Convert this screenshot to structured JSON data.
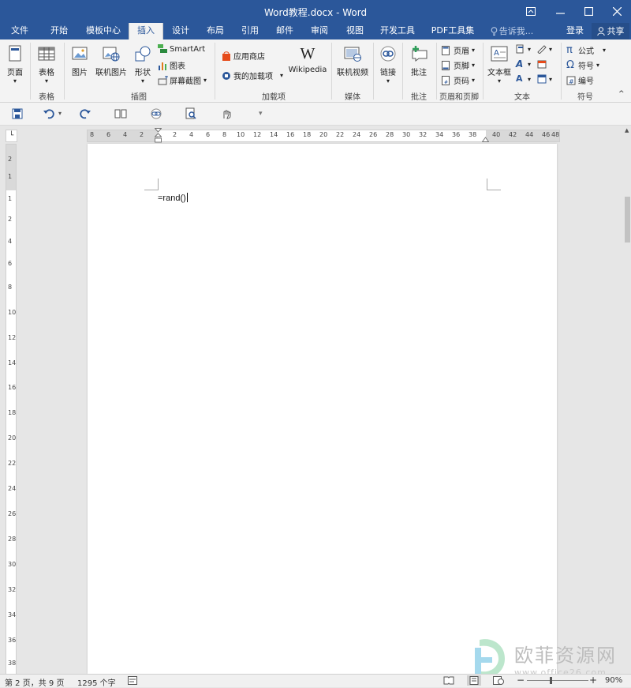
{
  "window": {
    "title": "Word教程.docx - Word",
    "controls": [
      "restore-ribbon",
      "minimize",
      "maximize",
      "close"
    ]
  },
  "tabs": [
    {
      "label": "文件"
    },
    {
      "label": "开始"
    },
    {
      "label": "模板中心"
    },
    {
      "label": "插入"
    },
    {
      "label": "设计"
    },
    {
      "label": "布局"
    },
    {
      "label": "引用"
    },
    {
      "label": "邮件"
    },
    {
      "label": "审阅"
    },
    {
      "label": "视图"
    },
    {
      "label": "开发工具"
    },
    {
      "label": "PDF工具集"
    }
  ],
  "active_tab": "插入",
  "tell_me": "告诉我...",
  "login": "登录",
  "share": "共享",
  "ribbon": {
    "page_btn": "页面",
    "table_btn": "表格",
    "table_group": "表格",
    "picture_btn": "图片",
    "online_picture_btn": "联机图片",
    "shapes_btn": "形状",
    "smartart_btn": "SmartArt",
    "chart_btn": "图表",
    "screenshot_btn": "屏幕截图",
    "illustrations_group": "插图",
    "store_btn": "应用商店",
    "my_addins_btn": "我的加载项",
    "wikipedia_btn": "Wikipedia",
    "addins_group": "加载项",
    "online_video_btn": "联机视频",
    "media_group": "媒体",
    "link_btn": "链接",
    "comment_btn": "批注",
    "comments_group": "批注",
    "header_btn": "页眉",
    "footer_btn": "页脚",
    "page_number_btn": "页码",
    "header_footer_group": "页眉和页脚",
    "textbox_btn": "文本框",
    "text_group": "文本",
    "equation_btn": "公式",
    "symbol_btn": "符号",
    "number_btn": "编号",
    "symbols_group": "符号"
  },
  "ruler": {
    "h_numbers": [
      "8",
      "6",
      "4",
      "2",
      "2",
      "4",
      "6",
      "8",
      "10",
      "12",
      "14",
      "16",
      "18",
      "20",
      "22",
      "24",
      "26",
      "28",
      "30",
      "32",
      "34",
      "36",
      "38",
      "40",
      "42",
      "44",
      "46",
      "48"
    ],
    "v_numbers": [
      "2",
      "1",
      "1",
      "2",
      "4",
      "6",
      "8",
      "10",
      "12",
      "14",
      "16",
      "18",
      "20",
      "22",
      "24",
      "26",
      "28",
      "30",
      "32",
      "34",
      "36",
      "38"
    ]
  },
  "document": {
    "text": "=rand()"
  },
  "status": {
    "page": "第 2 页，共 9 页",
    "words": "1295 个字",
    "zoom": "90%"
  },
  "watermark": {
    "cn": "欧菲资源网",
    "url": "www.office26.com"
  },
  "colors": {
    "title_bar": "#2b579a",
    "ribbon_bg": "#f3f3f3"
  }
}
